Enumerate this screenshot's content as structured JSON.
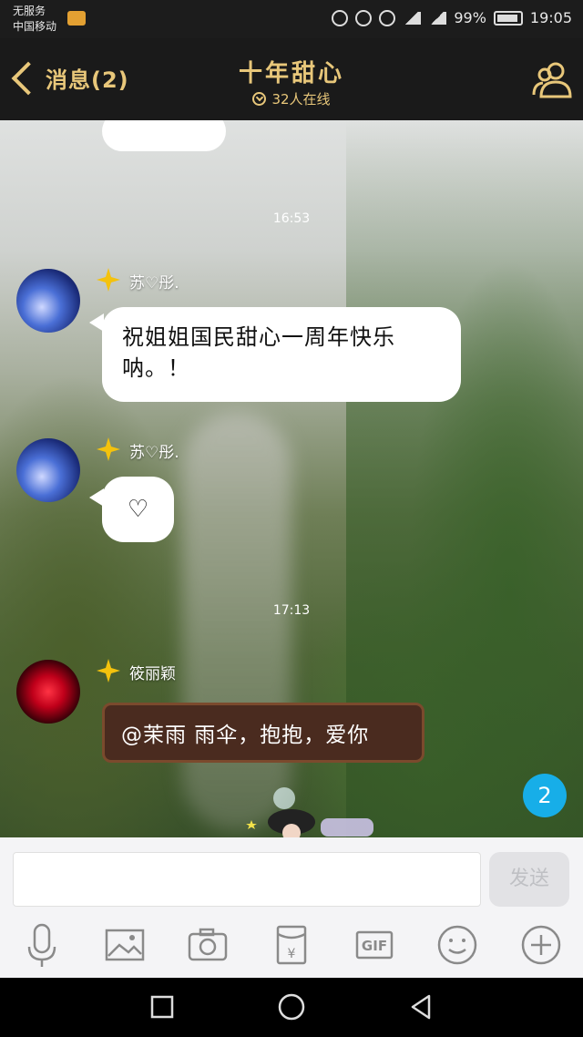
{
  "status_bar": {
    "carrier_line1": "无服务",
    "carrier_line2": "中国移动",
    "battery_percent": "99%",
    "time": "19:05"
  },
  "nav": {
    "back_label": "消息(2)",
    "title": "十年甜心",
    "subtitle": "32人在线"
  },
  "chat": {
    "messages": [
      {
        "sender": "苏♡彤.",
        "text": "祝姐姐国民甜心一周年快乐呐。！"
      },
      {
        "sender": "苏♡彤.",
        "text": "♡"
      },
      {
        "sender": "筱丽颖",
        "text": "@茉雨 雨伞，抱抱，爱你"
      }
    ],
    "timestamps": [
      "16:53",
      "17:13"
    ],
    "new_message_count": "2"
  },
  "input": {
    "send_label": "发送"
  },
  "toolbar_icons": [
    "microphone-icon",
    "image-icon",
    "camera-icon",
    "red-packet-icon",
    "gif-icon",
    "emoji-icon",
    "plus-icon"
  ],
  "colors": {
    "nav_gold": "#e8c77a",
    "badge_blue": "#17aee8",
    "nav_bg": "#1a1a1a"
  }
}
